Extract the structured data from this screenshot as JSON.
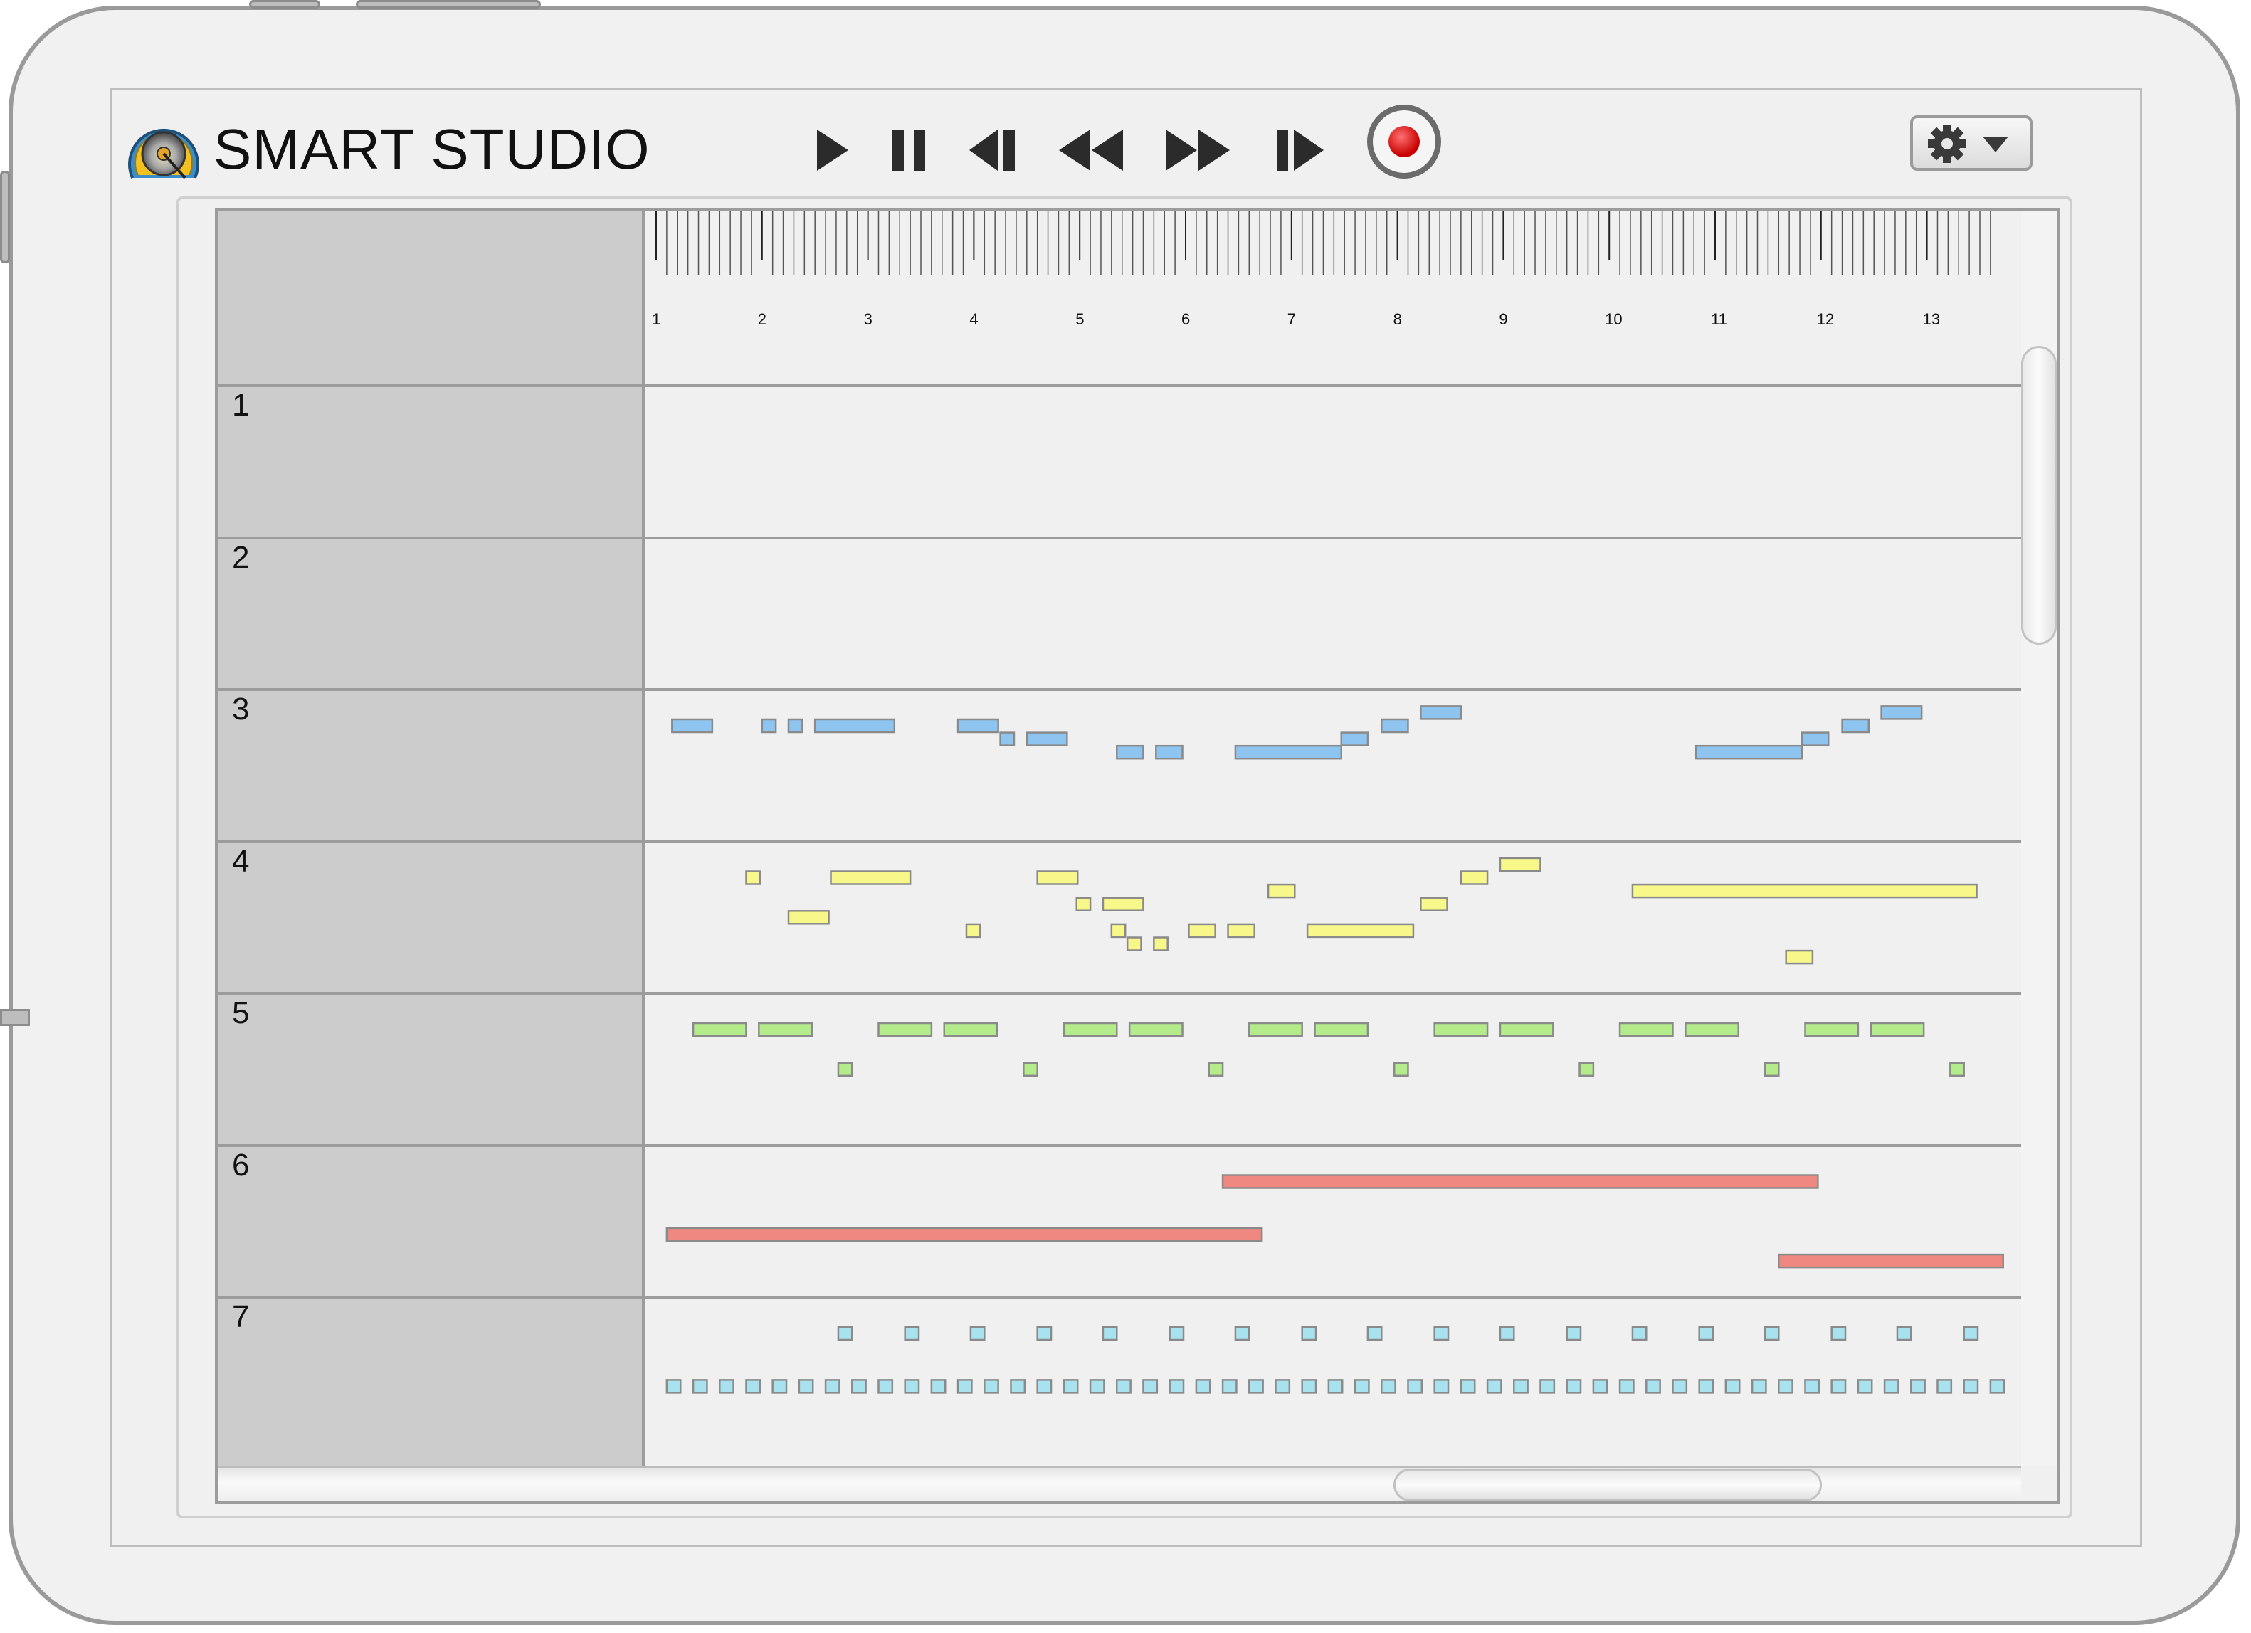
{
  "app": {
    "title": "SMART STUDIO",
    "logo_icon": "speaker-dial-icon"
  },
  "transport": {
    "buttons": [
      {
        "name": "play",
        "icon": "play-icon"
      },
      {
        "name": "pause",
        "icon": "pause-icon"
      },
      {
        "name": "skip-back",
        "icon": "skip-back-icon"
      },
      {
        "name": "rewind",
        "icon": "rewind-icon"
      },
      {
        "name": "fast-forward",
        "icon": "fast-forward-icon"
      },
      {
        "name": "skip-forward",
        "icon": "skip-forward-icon"
      }
    ],
    "record_icon": "record-icon",
    "record_color": "#e01010"
  },
  "settings": {
    "icons": [
      "gear-icon",
      "chevron-down-icon"
    ]
  },
  "ruler": {
    "bars": [
      "1",
      "2",
      "3",
      "4",
      "5",
      "6",
      "7",
      "8",
      "9",
      "10",
      "11",
      "12",
      "13"
    ]
  },
  "tracks": [
    {
      "label": "1",
      "color": null,
      "notes": []
    },
    {
      "label": "2",
      "color": null,
      "notes": []
    },
    {
      "label": "3",
      "color": "#8ec4f0",
      "notes": [
        {
          "start": 1.15,
          "len": 0.38,
          "lane": 0
        },
        {
          "start": 2.0,
          "len": 0.13,
          "lane": 0
        },
        {
          "start": 2.25,
          "len": 0.13,
          "lane": 0
        },
        {
          "start": 2.5,
          "len": 0.75,
          "lane": 0
        },
        {
          "start": 3.85,
          "len": 0.38,
          "lane": 0
        },
        {
          "start": 4.25,
          "len": 0.13,
          "lane": 1
        },
        {
          "start": 4.5,
          "len": 0.38,
          "lane": 1
        },
        {
          "start": 5.35,
          "len": 0.25,
          "lane": 2
        },
        {
          "start": 5.72,
          "len": 0.25,
          "lane": 2
        },
        {
          "start": 6.47,
          "len": 1.0,
          "lane": 2
        },
        {
          "start": 7.47,
          "len": 0.25,
          "lane": 1
        },
        {
          "start": 7.85,
          "len": 0.25,
          "lane": 0
        },
        {
          "start": 8.22,
          "len": 0.38,
          "lane": -1
        },
        {
          "start": 10.82,
          "len": 1.0,
          "lane": 2
        },
        {
          "start": 11.82,
          "len": 0.25,
          "lane": 1
        },
        {
          "start": 12.2,
          "len": 0.25,
          "lane": 0
        },
        {
          "start": 12.57,
          "len": 0.38,
          "lane": -1
        }
      ]
    },
    {
      "label": "4",
      "color": "#f7f78a",
      "notes": [
        {
          "start": 1.85,
          "len": 0.13,
          "lane": 0
        },
        {
          "start": 2.25,
          "len": 0.38,
          "lane": 3
        },
        {
          "start": 2.65,
          "len": 0.75,
          "lane": 0
        },
        {
          "start": 3.93,
          "len": 0.13,
          "lane": 4
        },
        {
          "start": 4.6,
          "len": 0.38,
          "lane": 0
        },
        {
          "start": 4.97,
          "len": 0.13,
          "lane": 2
        },
        {
          "start": 5.22,
          "len": 0.38,
          "lane": 2
        },
        {
          "start": 5.3,
          "len": 0.13,
          "lane": 4
        },
        {
          "start": 5.45,
          "len": 0.13,
          "lane": 5
        },
        {
          "start": 5.7,
          "len": 0.13,
          "lane": 5
        },
        {
          "start": 6.03,
          "len": 0.25,
          "lane": 4
        },
        {
          "start": 6.4,
          "len": 0.25,
          "lane": 4
        },
        {
          "start": 6.78,
          "len": 0.25,
          "lane": 1
        },
        {
          "start": 7.15,
          "len": 1.0,
          "lane": 4
        },
        {
          "start": 8.22,
          "len": 0.25,
          "lane": 2
        },
        {
          "start": 8.6,
          "len": 0.25,
          "lane": 0
        },
        {
          "start": 8.97,
          "len": 0.38,
          "lane": -1
        },
        {
          "start": 10.22,
          "len": 3.25,
          "lane": 1
        },
        {
          "start": 11.67,
          "len": 0.25,
          "lane": 6
        }
      ]
    },
    {
      "label": "5",
      "color": "#b4ec8c",
      "notes": [
        {
          "start": 1.35,
          "len": 0.5,
          "lane": 0
        },
        {
          "start": 1.97,
          "len": 0.5,
          "lane": 0
        },
        {
          "start": 2.72,
          "len": 0.13,
          "lane": 3
        },
        {
          "start": 3.1,
          "len": 0.5,
          "lane": 0
        },
        {
          "start": 3.72,
          "len": 0.5,
          "lane": 0
        },
        {
          "start": 4.47,
          "len": 0.13,
          "lane": 3
        },
        {
          "start": 4.85,
          "len": 0.5,
          "lane": 0
        },
        {
          "start": 5.47,
          "len": 0.5,
          "lane": 0
        },
        {
          "start": 6.22,
          "len": 0.13,
          "lane": 3
        },
        {
          "start": 6.6,
          "len": 0.5,
          "lane": 0
        },
        {
          "start": 7.22,
          "len": 0.5,
          "lane": 0
        },
        {
          "start": 7.97,
          "len": 0.13,
          "lane": 3
        },
        {
          "start": 8.35,
          "len": 0.5,
          "lane": 0
        },
        {
          "start": 8.97,
          "len": 0.5,
          "lane": 0
        },
        {
          "start": 9.72,
          "len": 0.13,
          "lane": 3
        },
        {
          "start": 10.1,
          "len": 0.5,
          "lane": 0
        },
        {
          "start": 10.72,
          "len": 0.5,
          "lane": 0
        },
        {
          "start": 11.47,
          "len": 0.13,
          "lane": 3
        },
        {
          "start": 11.85,
          "len": 0.5,
          "lane": 0
        },
        {
          "start": 12.47,
          "len": 0.5,
          "lane": 0
        },
        {
          "start": 13.22,
          "len": 0.13,
          "lane": 3
        }
      ]
    },
    {
      "label": "6",
      "color": "#ef8880",
      "notes": [
        {
          "start": 6.35,
          "len": 5.62,
          "lane": 0
        },
        {
          "start": 1.1,
          "len": 5.62,
          "lane": 4
        },
        {
          "start": 11.6,
          "len": 2.12,
          "lane": 6
        }
      ]
    },
    {
      "label": "7",
      "color": "#a8e2ee",
      "notes": [
        {
          "start": 2.72,
          "len": 0.13,
          "lane": 0
        },
        {
          "start": 3.35,
          "len": 0.13,
          "lane": 0
        },
        {
          "start": 3.97,
          "len": 0.13,
          "lane": 0
        },
        {
          "start": 4.6,
          "len": 0.13,
          "lane": 0
        },
        {
          "start": 5.22,
          "len": 0.13,
          "lane": 0
        },
        {
          "start": 5.85,
          "len": 0.13,
          "lane": 0
        },
        {
          "start": 6.47,
          "len": 0.13,
          "lane": 0
        },
        {
          "start": 7.1,
          "len": 0.13,
          "lane": 0
        },
        {
          "start": 7.72,
          "len": 0.13,
          "lane": 0
        },
        {
          "start": 8.35,
          "len": 0.13,
          "lane": 0
        },
        {
          "start": 8.97,
          "len": 0.13,
          "lane": 0
        },
        {
          "start": 9.6,
          "len": 0.13,
          "lane": 0
        },
        {
          "start": 10.22,
          "len": 0.13,
          "lane": 0
        },
        {
          "start": 10.85,
          "len": 0.13,
          "lane": 0
        },
        {
          "start": 11.47,
          "len": 0.13,
          "lane": 0
        },
        {
          "start": 12.1,
          "len": 0.13,
          "lane": 0
        },
        {
          "start": 12.72,
          "len": 0.13,
          "lane": 0
        },
        {
          "start": 13.35,
          "len": 0.13,
          "lane": 0
        }
      ],
      "pulse": {
        "start": 1.1,
        "step": 0.25,
        "count": 51,
        "len": 0.13,
        "lane": 4
      }
    }
  ]
}
